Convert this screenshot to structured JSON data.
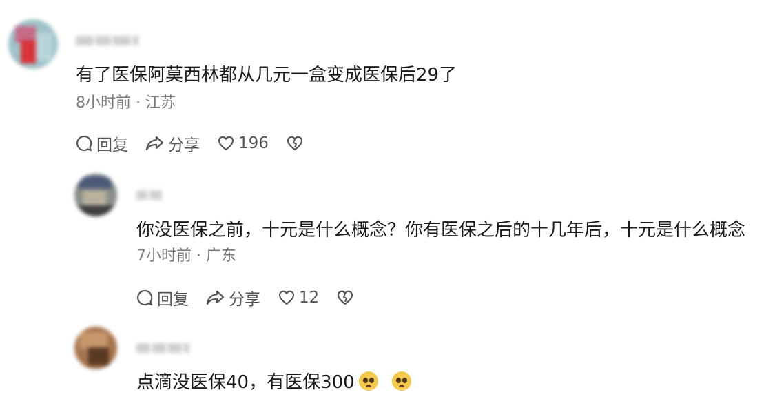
{
  "comments": [
    {
      "text": "有了医保阿莫西林都从几元一盒变成医保后29了",
      "meta": "8小时前 · 江苏",
      "reply_label": "回复",
      "share_label": "分享",
      "like_count": "196"
    },
    {
      "text": "你没医保之前，十元是什么概念？你有医保之后的十几年后，十元是什么概念",
      "meta": "7小时前 · 广东",
      "reply_label": "回复",
      "share_label": "分享",
      "like_count": "12"
    },
    {
      "text": "点滴没医保40，有医保300"
    }
  ],
  "icons": [
    "comment-icon",
    "share-icon",
    "heart-icon",
    "broken-heart-icon",
    "pleading-face-emoji"
  ],
  "colors": {
    "text": "#1a1a1a",
    "meta": "#7a7a7a",
    "action": "#555555",
    "background": "#ffffff"
  }
}
